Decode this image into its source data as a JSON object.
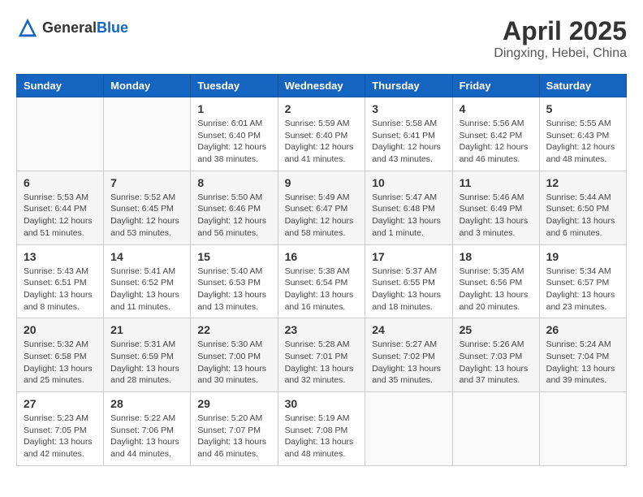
{
  "header": {
    "logo_general": "General",
    "logo_blue": "Blue",
    "month": "April 2025",
    "location": "Dingxing, Hebei, China"
  },
  "weekdays": [
    "Sunday",
    "Monday",
    "Tuesday",
    "Wednesday",
    "Thursday",
    "Friday",
    "Saturday"
  ],
  "weeks": [
    [
      {
        "day": "",
        "info": ""
      },
      {
        "day": "",
        "info": ""
      },
      {
        "day": "1",
        "info": "Sunrise: 6:01 AM\nSunset: 6:40 PM\nDaylight: 12 hours and 38 minutes."
      },
      {
        "day": "2",
        "info": "Sunrise: 5:59 AM\nSunset: 6:40 PM\nDaylight: 12 hours and 41 minutes."
      },
      {
        "day": "3",
        "info": "Sunrise: 5:58 AM\nSunset: 6:41 PM\nDaylight: 12 hours and 43 minutes."
      },
      {
        "day": "4",
        "info": "Sunrise: 5:56 AM\nSunset: 6:42 PM\nDaylight: 12 hours and 46 minutes."
      },
      {
        "day": "5",
        "info": "Sunrise: 5:55 AM\nSunset: 6:43 PM\nDaylight: 12 hours and 48 minutes."
      }
    ],
    [
      {
        "day": "6",
        "info": "Sunrise: 5:53 AM\nSunset: 6:44 PM\nDaylight: 12 hours and 51 minutes."
      },
      {
        "day": "7",
        "info": "Sunrise: 5:52 AM\nSunset: 6:45 PM\nDaylight: 12 hours and 53 minutes."
      },
      {
        "day": "8",
        "info": "Sunrise: 5:50 AM\nSunset: 6:46 PM\nDaylight: 12 hours and 56 minutes."
      },
      {
        "day": "9",
        "info": "Sunrise: 5:49 AM\nSunset: 6:47 PM\nDaylight: 12 hours and 58 minutes."
      },
      {
        "day": "10",
        "info": "Sunrise: 5:47 AM\nSunset: 6:48 PM\nDaylight: 13 hours and 1 minute."
      },
      {
        "day": "11",
        "info": "Sunrise: 5:46 AM\nSunset: 6:49 PM\nDaylight: 13 hours and 3 minutes."
      },
      {
        "day": "12",
        "info": "Sunrise: 5:44 AM\nSunset: 6:50 PM\nDaylight: 13 hours and 6 minutes."
      }
    ],
    [
      {
        "day": "13",
        "info": "Sunrise: 5:43 AM\nSunset: 6:51 PM\nDaylight: 13 hours and 8 minutes."
      },
      {
        "day": "14",
        "info": "Sunrise: 5:41 AM\nSunset: 6:52 PM\nDaylight: 13 hours and 11 minutes."
      },
      {
        "day": "15",
        "info": "Sunrise: 5:40 AM\nSunset: 6:53 PM\nDaylight: 13 hours and 13 minutes."
      },
      {
        "day": "16",
        "info": "Sunrise: 5:38 AM\nSunset: 6:54 PM\nDaylight: 13 hours and 16 minutes."
      },
      {
        "day": "17",
        "info": "Sunrise: 5:37 AM\nSunset: 6:55 PM\nDaylight: 13 hours and 18 minutes."
      },
      {
        "day": "18",
        "info": "Sunrise: 5:35 AM\nSunset: 6:56 PM\nDaylight: 13 hours and 20 minutes."
      },
      {
        "day": "19",
        "info": "Sunrise: 5:34 AM\nSunset: 6:57 PM\nDaylight: 13 hours and 23 minutes."
      }
    ],
    [
      {
        "day": "20",
        "info": "Sunrise: 5:32 AM\nSunset: 6:58 PM\nDaylight: 13 hours and 25 minutes."
      },
      {
        "day": "21",
        "info": "Sunrise: 5:31 AM\nSunset: 6:59 PM\nDaylight: 13 hours and 28 minutes."
      },
      {
        "day": "22",
        "info": "Sunrise: 5:30 AM\nSunset: 7:00 PM\nDaylight: 13 hours and 30 minutes."
      },
      {
        "day": "23",
        "info": "Sunrise: 5:28 AM\nSunset: 7:01 PM\nDaylight: 13 hours and 32 minutes."
      },
      {
        "day": "24",
        "info": "Sunrise: 5:27 AM\nSunset: 7:02 PM\nDaylight: 13 hours and 35 minutes."
      },
      {
        "day": "25",
        "info": "Sunrise: 5:26 AM\nSunset: 7:03 PM\nDaylight: 13 hours and 37 minutes."
      },
      {
        "day": "26",
        "info": "Sunrise: 5:24 AM\nSunset: 7:04 PM\nDaylight: 13 hours and 39 minutes."
      }
    ],
    [
      {
        "day": "27",
        "info": "Sunrise: 5:23 AM\nSunset: 7:05 PM\nDaylight: 13 hours and 42 minutes."
      },
      {
        "day": "28",
        "info": "Sunrise: 5:22 AM\nSunset: 7:06 PM\nDaylight: 13 hours and 44 minutes."
      },
      {
        "day": "29",
        "info": "Sunrise: 5:20 AM\nSunset: 7:07 PM\nDaylight: 13 hours and 46 minutes."
      },
      {
        "day": "30",
        "info": "Sunrise: 5:19 AM\nSunset: 7:08 PM\nDaylight: 13 hours and 48 minutes."
      },
      {
        "day": "",
        "info": ""
      },
      {
        "day": "",
        "info": ""
      },
      {
        "day": "",
        "info": ""
      }
    ]
  ]
}
